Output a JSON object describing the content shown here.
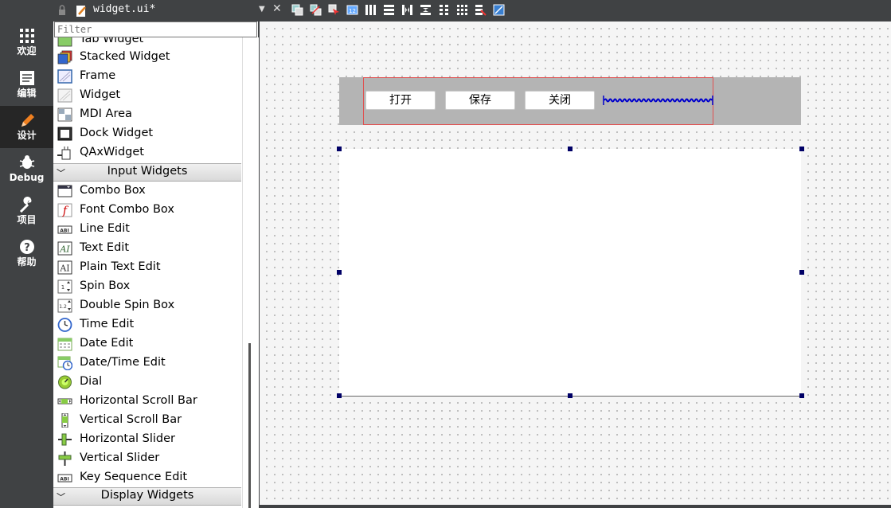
{
  "modes": [
    {
      "label": "欢迎",
      "icon": "grid-icon"
    },
    {
      "label": "编辑",
      "icon": "document-icon"
    },
    {
      "label": "设计",
      "icon": "pencil-icon",
      "active": true
    },
    {
      "label": "Debug",
      "icon": "bug-icon"
    },
    {
      "label": "项目",
      "icon": "wrench-icon"
    },
    {
      "label": "帮助",
      "icon": "help-icon"
    }
  ],
  "editor": {
    "file_name": "widget.ui*"
  },
  "widgetbox": {
    "filter_placeholder": "Filter",
    "partial_top": "Tab Widget",
    "containers": [
      "Stacked Widget",
      "Frame",
      "Widget",
      "MDI Area",
      "Dock Widget",
      "QAxWidget"
    ],
    "input_category": "Input Widgets",
    "inputs": [
      "Combo Box",
      "Font Combo Box",
      "Line Edit",
      "Text Edit",
      "Plain Text Edit",
      "Spin Box",
      "Double Spin Box",
      "Time Edit",
      "Date Edit",
      "Date/Time Edit",
      "Dial",
      "Horizontal Scroll Bar",
      "Vertical Scroll Bar",
      "Horizontal Slider",
      "Vertical Slider",
      "Key Sequence Edit"
    ],
    "display_category": "Display Widgets"
  },
  "form": {
    "buttons": [
      "打开",
      "保存",
      "关闭"
    ]
  },
  "colors": {
    "sidebar": "#404244",
    "active_mode": "#262626",
    "layout_border": "#e05050",
    "handle": "#000066",
    "toolbar_frame": "#b4b4b4"
  }
}
